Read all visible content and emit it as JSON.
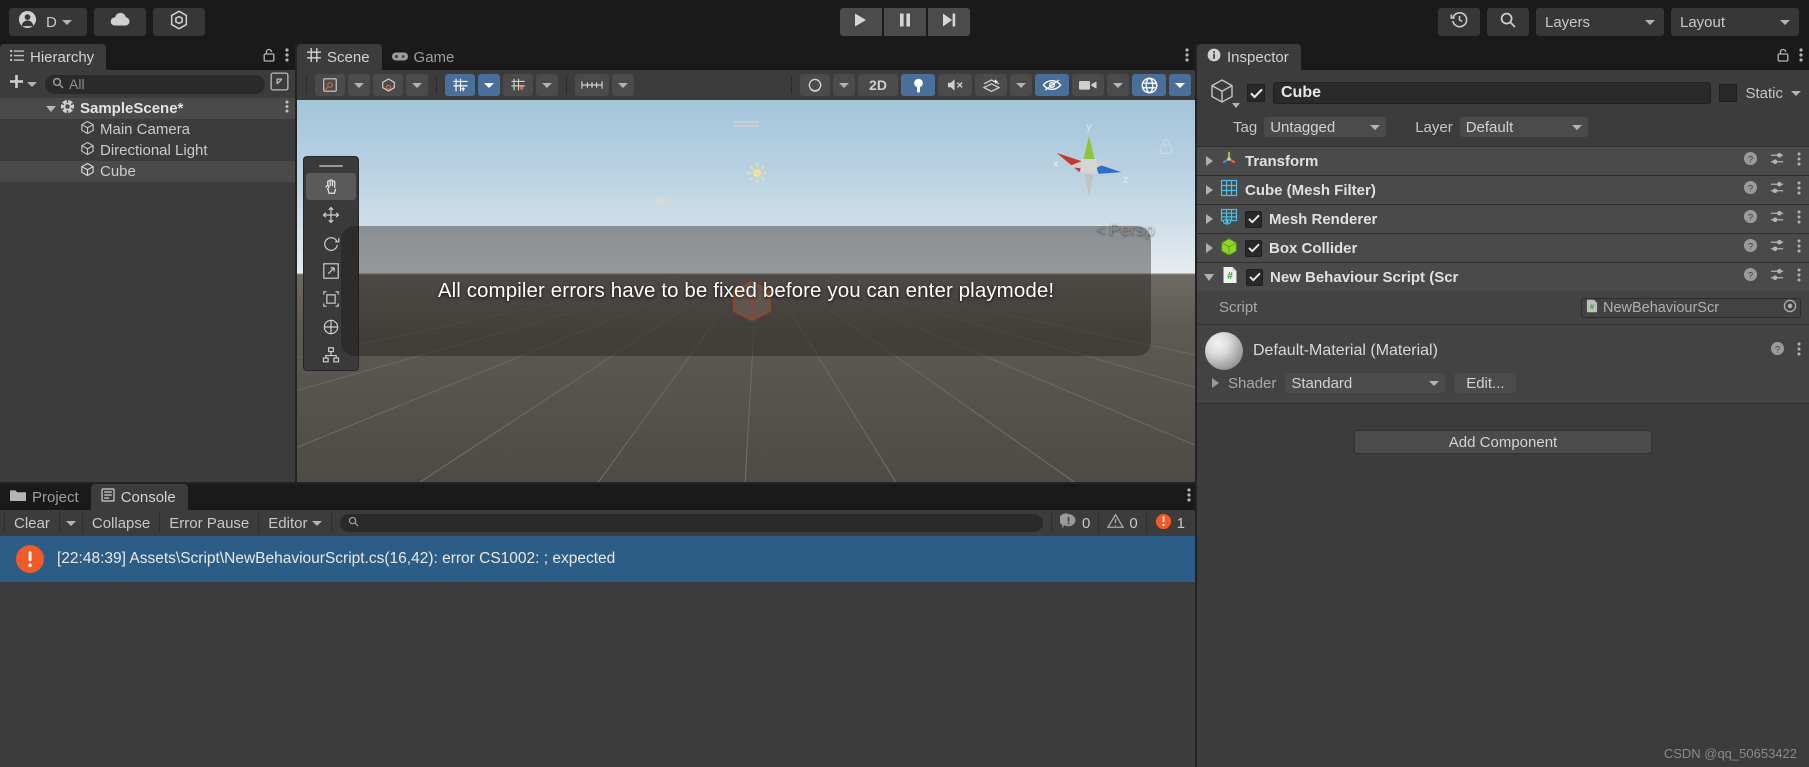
{
  "topbar": {
    "account": {
      "label": "D",
      "icon": "account-icon"
    },
    "cloud": {
      "icon": "cloud-icon"
    },
    "services": {
      "icon": "unity-services-icon"
    },
    "play": "play-icon",
    "pause": "pause-icon",
    "step": "step-icon",
    "undo_history": "undo-history-icon",
    "search": "search-icon",
    "layers": "Layers",
    "layout": "Layout"
  },
  "hierarchy": {
    "tab": "Hierarchy",
    "create_label": "+",
    "search_placeholder": "All",
    "scene_name": "SampleScene*",
    "items": [
      {
        "label": "Main Camera",
        "selected": false
      },
      {
        "label": "Directional Light",
        "selected": false
      },
      {
        "label": "Cube",
        "selected": true
      }
    ]
  },
  "scene": {
    "tabs": [
      {
        "label": "Scene",
        "active": true,
        "icon": "grid-icon"
      },
      {
        "label": "Game",
        "active": false,
        "icon": "gamepad-icon"
      }
    ],
    "toolbar": {
      "pivot_mode": "pivot-icon",
      "pivot_rotation": "global-icon",
      "grid_snap": "grid-snapping-icon",
      "grid_visual": "grid-visual-icon",
      "snap_increment": "snap-increment-icon",
      "draw_mode": "shaded-mode-icon",
      "twod": "2D",
      "lighting": "lighting-icon",
      "audio": "audio-mute-icon",
      "effects": "effects-icon",
      "hidden_objects": "hidden-objects-icon",
      "camera": "scene-camera-icon",
      "gizmos": "gizmos-icon"
    },
    "tools": [
      {
        "name": "hand-tool",
        "active": true
      },
      {
        "name": "move-tool",
        "active": false
      },
      {
        "name": "rotate-tool",
        "active": false
      },
      {
        "name": "scale-tool",
        "active": false
      },
      {
        "name": "rect-tool",
        "active": false
      },
      {
        "name": "transform-tool",
        "active": false
      },
      {
        "name": "custom-tool",
        "active": false
      }
    ],
    "gizmo": {
      "axis_x": "x",
      "axis_y": "y",
      "axis_z": "z",
      "perspective_label": "Persp",
      "color_x": "#c4392f",
      "color_y": "#8fc43b",
      "color_z": "#2f6fc4"
    },
    "notification": "All compiler errors have to be fixed before you can enter playmode!"
  },
  "inspector": {
    "tab": "Inspector",
    "object": {
      "name": "Cube",
      "enabled": true,
      "static_label": "Static",
      "static_checked": false,
      "tag_label": "Tag",
      "tag_value": "Untagged",
      "layer_label": "Layer",
      "layer_value": "Default"
    },
    "components": [
      {
        "title": "Transform",
        "icon": "transform-icon",
        "has_toggle": false,
        "expanded": false
      },
      {
        "title": "Cube (Mesh Filter)",
        "icon": "mesh-filter-icon",
        "has_toggle": false,
        "expanded": false
      },
      {
        "title": "Mesh Renderer",
        "icon": "mesh-renderer-icon",
        "has_toggle": true,
        "enabled": true,
        "expanded": false
      },
      {
        "title": "Box Collider",
        "icon": "box-collider-icon",
        "has_toggle": true,
        "enabled": true,
        "expanded": false
      },
      {
        "title": "New Behaviour Script (Scr",
        "icon": "cs-script-icon",
        "has_toggle": true,
        "enabled": true,
        "expanded": true
      }
    ],
    "script_field": {
      "label": "Script",
      "value": "NewBehaviourScr"
    },
    "material": {
      "title": "Default-Material (Material)",
      "shader_label": "Shader",
      "shader_value": "Standard",
      "edit_label": "Edit..."
    },
    "add_component": "Add Component"
  },
  "bottom": {
    "tabs": [
      {
        "label": "Project",
        "active": false,
        "icon": "folder-icon"
      },
      {
        "label": "Console",
        "active": true,
        "icon": "console-icon"
      }
    ],
    "toolbar": {
      "clear": "Clear",
      "collapse": "Collapse",
      "error_pause": "Error Pause",
      "editor": "Editor",
      "search_placeholder": ""
    },
    "counters": {
      "log": "0",
      "warning": "0",
      "error": "1"
    },
    "entries": [
      {
        "timestamp": "[22:48:39]",
        "message": "[22:48:39] Assets\\Script\\NewBehaviourScript.cs(16,42): error CS1002: ; expected",
        "severity": "error",
        "selected": true
      }
    ]
  },
  "watermark": "CSDN @qq_50653422",
  "colors": {
    "accent_blue": "#4a6f9a",
    "selection_blue": "#2c5d87",
    "error_orange": "#f05a28",
    "panel_bg": "#3c3c3c",
    "toolbar_bg": "#1a1a1a"
  }
}
